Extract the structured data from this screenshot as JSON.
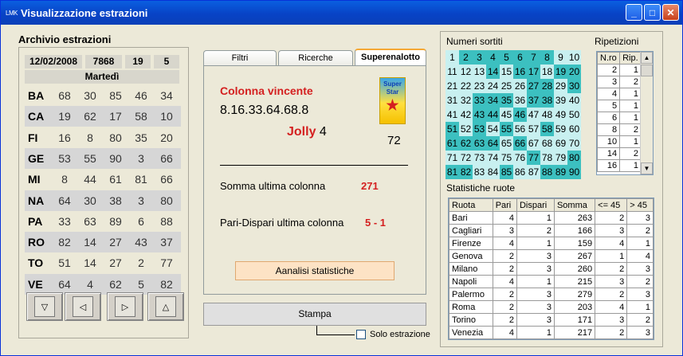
{
  "window": {
    "logo": "LMK",
    "title": "Visualizzazione estrazioni"
  },
  "archive": {
    "label": "Archivio estrazioni",
    "date": "12/02/2008",
    "number": "7868",
    "n1": "19",
    "n2": "5",
    "weekday": "Martedì",
    "rows": [
      {
        "city": "BA",
        "nums": [
          "68",
          "30",
          "85",
          "46",
          "34"
        ]
      },
      {
        "city": "CA",
        "nums": [
          "19",
          "62",
          "17",
          "58",
          "10"
        ]
      },
      {
        "city": "FI",
        "nums": [
          "16",
          "8",
          "80",
          "35",
          "20"
        ]
      },
      {
        "city": "GE",
        "nums": [
          "53",
          "55",
          "90",
          "3",
          "66"
        ]
      },
      {
        "city": "MI",
        "nums": [
          "8",
          "44",
          "61",
          "81",
          "66"
        ]
      },
      {
        "city": "NA",
        "nums": [
          "64",
          "30",
          "38",
          "3",
          "80"
        ]
      },
      {
        "city": "PA",
        "nums": [
          "33",
          "63",
          "89",
          "6",
          "88"
        ]
      },
      {
        "city": "RO",
        "nums": [
          "82",
          "14",
          "27",
          "43",
          "37"
        ]
      },
      {
        "city": "TO",
        "nums": [
          "51",
          "14",
          "27",
          "2",
          "77"
        ]
      },
      {
        "city": "VE",
        "nums": [
          "64",
          "4",
          "62",
          "5",
          "82"
        ]
      }
    ]
  },
  "tabs": [
    "Filtri",
    "Ricerche",
    "Superenalotto"
  ],
  "superenalotto": {
    "colonna_label": "Colonna vincente",
    "colonna": "8.16.33.64.68.8",
    "jolly_label": "Jolly",
    "jolly": "4",
    "superstar": "72",
    "logo_text_1": "Super",
    "logo_text_2": "Star",
    "somma_label": "Somma ultima colonna",
    "somma": "271",
    "pari_label": "Pari-Dispari ultima colonna",
    "pari": "5 - 1",
    "analisi_button": "Aanalisi statistiche"
  },
  "stampa_button": "Stampa",
  "solo_estrazione": "Solo estrazione",
  "numeri_label": "Numeri sortiti",
  "hits": [
    2,
    3,
    4,
    5,
    6,
    7,
    8,
    14,
    16,
    17,
    19,
    20,
    27,
    28,
    30,
    33,
    34,
    35,
    37,
    38,
    43,
    44,
    46,
    51,
    53,
    55,
    58,
    61,
    62,
    63,
    64,
    66,
    77,
    80,
    81,
    82,
    85,
    88,
    89,
    90
  ],
  "ripetizioni": {
    "label": "Ripetizioni",
    "headers": [
      "N.ro",
      "Rip."
    ],
    "rows": [
      [
        "2",
        "1"
      ],
      [
        "3",
        "2"
      ],
      [
        "4",
        "1"
      ],
      [
        "5",
        "1"
      ],
      [
        "6",
        "1"
      ],
      [
        "8",
        "2"
      ],
      [
        "10",
        "1"
      ],
      [
        "14",
        "2"
      ],
      [
        "16",
        "1"
      ]
    ]
  },
  "statistiche": {
    "label": "Statistiche ruote",
    "headers": [
      "Ruota",
      "Pari",
      "Dispari",
      "Somma",
      "<= 45",
      "> 45"
    ],
    "rows": [
      [
        "Bari",
        "4",
        "1",
        "263",
        "2",
        "3"
      ],
      [
        "Cagliari",
        "3",
        "2",
        "166",
        "3",
        "2"
      ],
      [
        "Firenze",
        "4",
        "1",
        "159",
        "4",
        "1"
      ],
      [
        "Genova",
        "2",
        "3",
        "267",
        "1",
        "4"
      ],
      [
        "Milano",
        "2",
        "3",
        "260",
        "2",
        "3"
      ],
      [
        "Napoli",
        "4",
        "1",
        "215",
        "3",
        "2"
      ],
      [
        "Palermo",
        "2",
        "3",
        "279",
        "2",
        "3"
      ],
      [
        "Roma",
        "2",
        "3",
        "203",
        "4",
        "1"
      ],
      [
        "Torino",
        "2",
        "3",
        "171",
        "3",
        "2"
      ],
      [
        "Venezia",
        "4",
        "1",
        "217",
        "2",
        "3"
      ]
    ]
  }
}
